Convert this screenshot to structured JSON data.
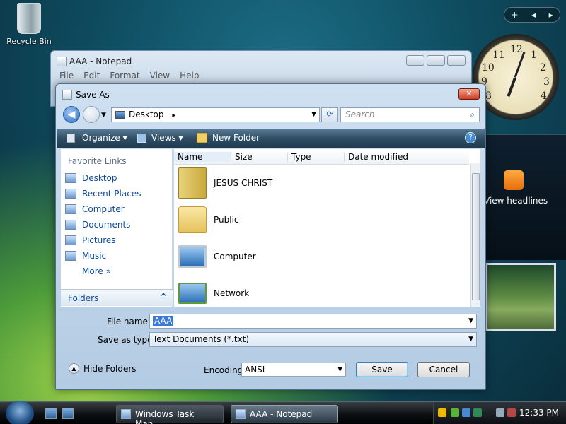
{
  "desktop": {
    "recycle_bin": "Recycle Bin"
  },
  "gadgets": {
    "controls": {
      "add": "+",
      "prev": "◂",
      "next": "▸"
    },
    "clock": {
      "numbers": [
        "12",
        "1",
        "2",
        "3",
        "4",
        "8",
        "9",
        "10",
        "11"
      ]
    },
    "feed": {
      "label": "View headlines"
    }
  },
  "notepad": {
    "title": "AAA - Notepad",
    "menu": [
      "File",
      "Edit",
      "Format",
      "View",
      "Help"
    ]
  },
  "dialog": {
    "title": "Save As",
    "close_glyph": "✕",
    "address": "Desktop",
    "address_arrow": "▸",
    "refresh_glyph": "⟳",
    "search_placeholder": "Search",
    "toolbar": {
      "organize": "Organize ▾",
      "views": "Views ▾",
      "new_folder": "New Folder",
      "help": "?"
    },
    "favorite_links": {
      "heading": "Favorite Links",
      "items": [
        "Desktop",
        "Recent Places",
        "Computer",
        "Documents",
        "Pictures",
        "Music"
      ],
      "more": "More »"
    },
    "folders_label": "Folders",
    "folders_chevron": "^",
    "columns": [
      "Name",
      "Size",
      "Type",
      "Date modified"
    ],
    "items": [
      "JESUS CHRIST",
      "Public",
      "Computer",
      "Network"
    ],
    "file_name_label": "File name:",
    "file_name_value": "AAA",
    "save_type_label": "Save as type:",
    "save_type_value": "Text Documents (*.txt)",
    "hide_folders": "Hide Folders",
    "hide_folders_glyph": "▲",
    "encoding_label": "Encoding:",
    "encoding_value": "ANSI",
    "save_button": "Save",
    "cancel_button": "Cancel",
    "combo_arrow": "▼"
  },
  "taskbar": {
    "tasks": [
      "Windows Task Man...",
      "AAA - Notepad"
    ],
    "time": "12:33 PM"
  }
}
